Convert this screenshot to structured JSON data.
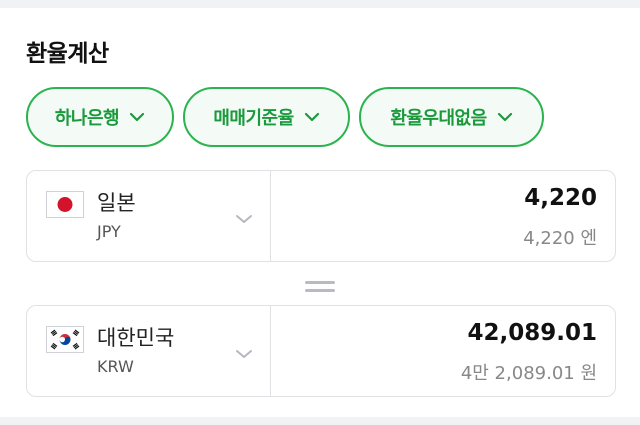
{
  "title": "환율계산",
  "filters": [
    {
      "label": "하나은행",
      "icon": "chevron-down-icon"
    },
    {
      "label": "매매기준율",
      "icon": "chevron-down-icon"
    },
    {
      "label": "환율우대없음",
      "icon": "chevron-down-icon"
    }
  ],
  "from": {
    "flag": "japan-flag",
    "name": "일본",
    "code": "JPY",
    "amount": "4,220",
    "amount_text": "4,220 엔"
  },
  "equals_icon": "equals-icon",
  "to": {
    "flag": "south-korea-flag",
    "name": "대한민국",
    "code": "KRW",
    "amount": "42,089.01",
    "amount_text": "4만 2,089.01 원"
  },
  "colors": {
    "accent": "#2bb34f",
    "accent_text": "#1a9a3c",
    "chip_bg": "#f4fbf6",
    "border": "#dfe1e5"
  }
}
